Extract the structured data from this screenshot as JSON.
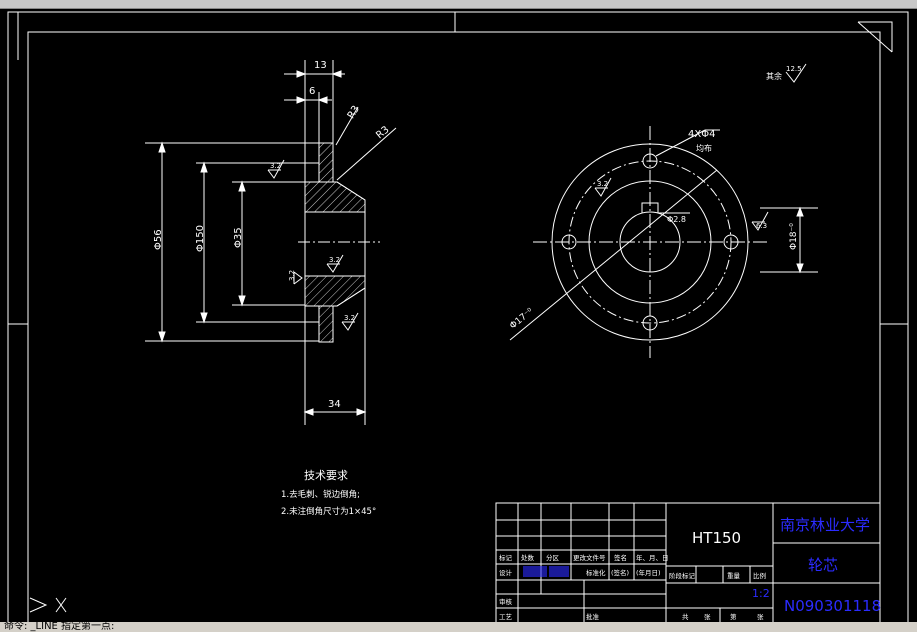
{
  "drawing": {
    "dims": {
      "top_13": "13",
      "top_6": "6",
      "radius_r3_a": "R3",
      "radius_r3_b": "R3",
      "dia_56": "Φ56",
      "dia_150": "Φ150",
      "dia_35": "Φ35",
      "width_34": "34",
      "holes": "4XΦ4",
      "holes_note": "均布",
      "key_width": "Φ18⁻⁰",
      "pcd": "Φ17⁻⁰",
      "key_depth": "Φ2.8"
    },
    "roughness": {
      "general": "12.5",
      "general_prefix": "其余",
      "r32_a": "3.2",
      "r32_b": "3.2",
      "r32_c": "3.2",
      "r32_d": "3.2",
      "r32_e": "3.2",
      "r63": "6.3"
    },
    "tech_requirements": {
      "title": "技术要求",
      "item1": "1.去毛刺、锐边倒角;",
      "item2": "2.未注倒角尺寸为1×45°"
    },
    "title_block": {
      "material": "HT150",
      "university": "南京林业大学",
      "part_name": "轮芯",
      "drawing_no": "N090301118",
      "scale": "1:2",
      "h_mark": "标记",
      "h_count": "处数",
      "h_zone": "分区",
      "h_doc": "更改文件号",
      "h_sign": "签名",
      "h_date": "年、月、日",
      "h_design": "设计",
      "h_std": "标准化",
      "h_sign2": "(签名)",
      "h_date2": "(年月日)",
      "h_stage": "阶段标记",
      "h_weight": "重量",
      "h_scale": "比例",
      "h_review": "审核",
      "h_process": "工艺",
      "h_approve": "批准",
      "h_total": "共",
      "h_sheet": "张",
      "h_di": "第",
      "h_zhang": "张"
    }
  },
  "cmdline": {
    "text": "命令: _LINE 指定第一点:"
  },
  "colors": {
    "background": "#000000",
    "line": "#ffffff",
    "blue_text": "#2b2bff"
  }
}
